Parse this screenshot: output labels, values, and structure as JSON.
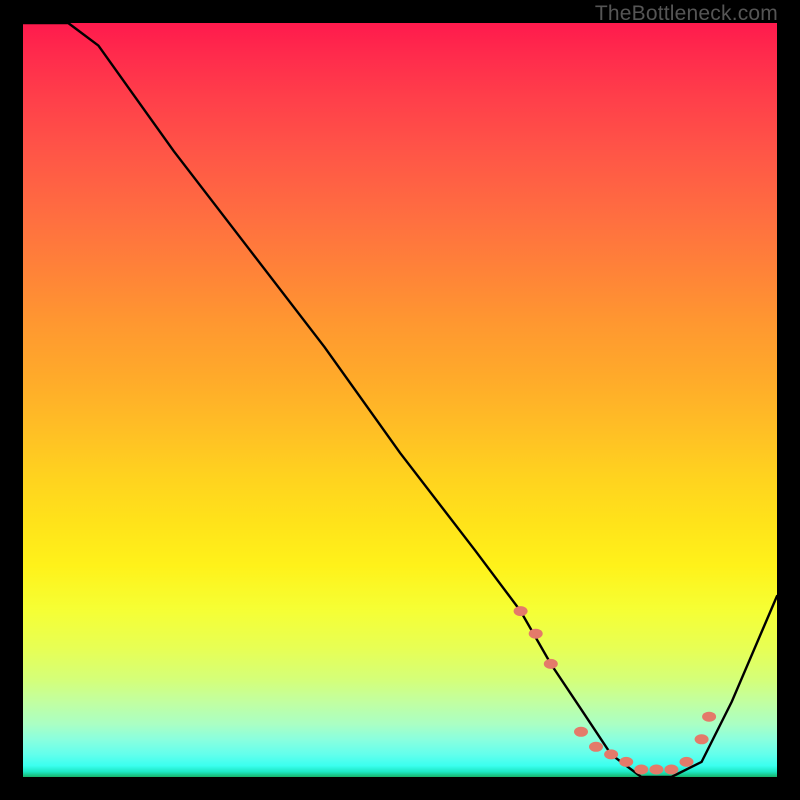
{
  "watermark": "TheBottleneck.com",
  "chart_data": {
    "type": "line",
    "title": "",
    "xlabel": "",
    "ylabel": "",
    "xlim": [
      0,
      100
    ],
    "ylim": [
      0,
      100
    ],
    "grid": false,
    "legend": false,
    "annotations": [],
    "series": [
      {
        "name": "curve",
        "color": "#000000",
        "x": [
          0,
          6,
          10,
          20,
          30,
          40,
          50,
          60,
          66,
          70,
          74,
          78,
          82,
          86,
          90,
          94,
          100
        ],
        "y": [
          100,
          100,
          97,
          83,
          70,
          57,
          43,
          30,
          22,
          15,
          9,
          3,
          0,
          0,
          2,
          10,
          24
        ]
      },
      {
        "name": "dots",
        "color": "#e47a6a",
        "type": "scatter",
        "x": [
          66,
          68,
          70,
          74,
          76,
          78,
          80,
          82,
          84,
          86,
          88,
          90,
          91
        ],
        "y": [
          22,
          19,
          15,
          6,
          4,
          3,
          2,
          1,
          1,
          1,
          2,
          5,
          8
        ]
      }
    ],
    "background_gradient": {
      "top": "#ff1a4d",
      "mid": "#ffe21a",
      "bottom": "#18b36b"
    }
  }
}
